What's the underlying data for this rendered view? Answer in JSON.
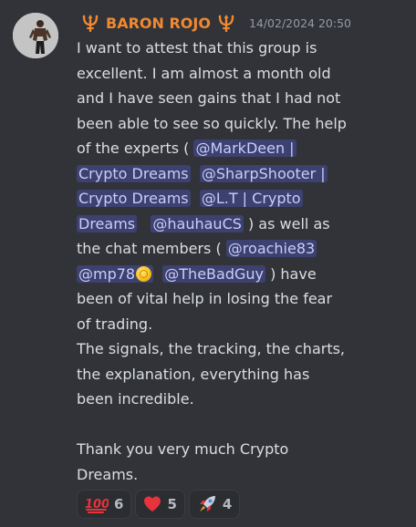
{
  "message": {
    "author": {
      "name": "BARON ROJO",
      "name_color": "#f0892f",
      "left_icon": "trident-icon",
      "right_icon": "trident-icon"
    },
    "timestamp": "14/02/2024 20:50",
    "lines": [
      "I want to attest that this group is",
      "excellent. I am almost a month old",
      "and I have seen gains that I had not",
      "been able to see so quickly. The help"
    ],
    "line5_prefix": "of the experts ( ",
    "mention_markdeen": "@MarkDeen |",
    "mention_markdeen_cont": "Crypto Dreams",
    "mention_sharpshooter": "@SharpShooter |",
    "mention_sharpshooter_cont": "Crypto Dreams",
    "mention_lt": "@L.T | Crypto",
    "mention_lt_cont": "Dreams",
    "mention_hauhau": "@hauhauCS",
    "line9_suffix": " ) as well as",
    "line10_prefix": "the chat members ( ",
    "mention_roachie": "@roachie83",
    "mention_mp78": "@mp78",
    "mention_thebadguy": "@TheBadGuy",
    "line11_suffix": " )  have",
    "line12": "been of vital help in losing the fear",
    "line13": "of trading.",
    "line14": "The signals, the tracking, the charts,",
    "line15": "the explanation, everything has",
    "line16": "been incredible.",
    "line18": "Thank you very much Crypto",
    "line19": "Dreams.",
    "mention_color": "#c9cdfb",
    "reactions": [
      {
        "emoji": "hundred-points-icon",
        "count": "6"
      },
      {
        "emoji": "red-heart-icon",
        "count": "5"
      },
      {
        "emoji": "rocket-icon",
        "count": "4"
      }
    ]
  }
}
